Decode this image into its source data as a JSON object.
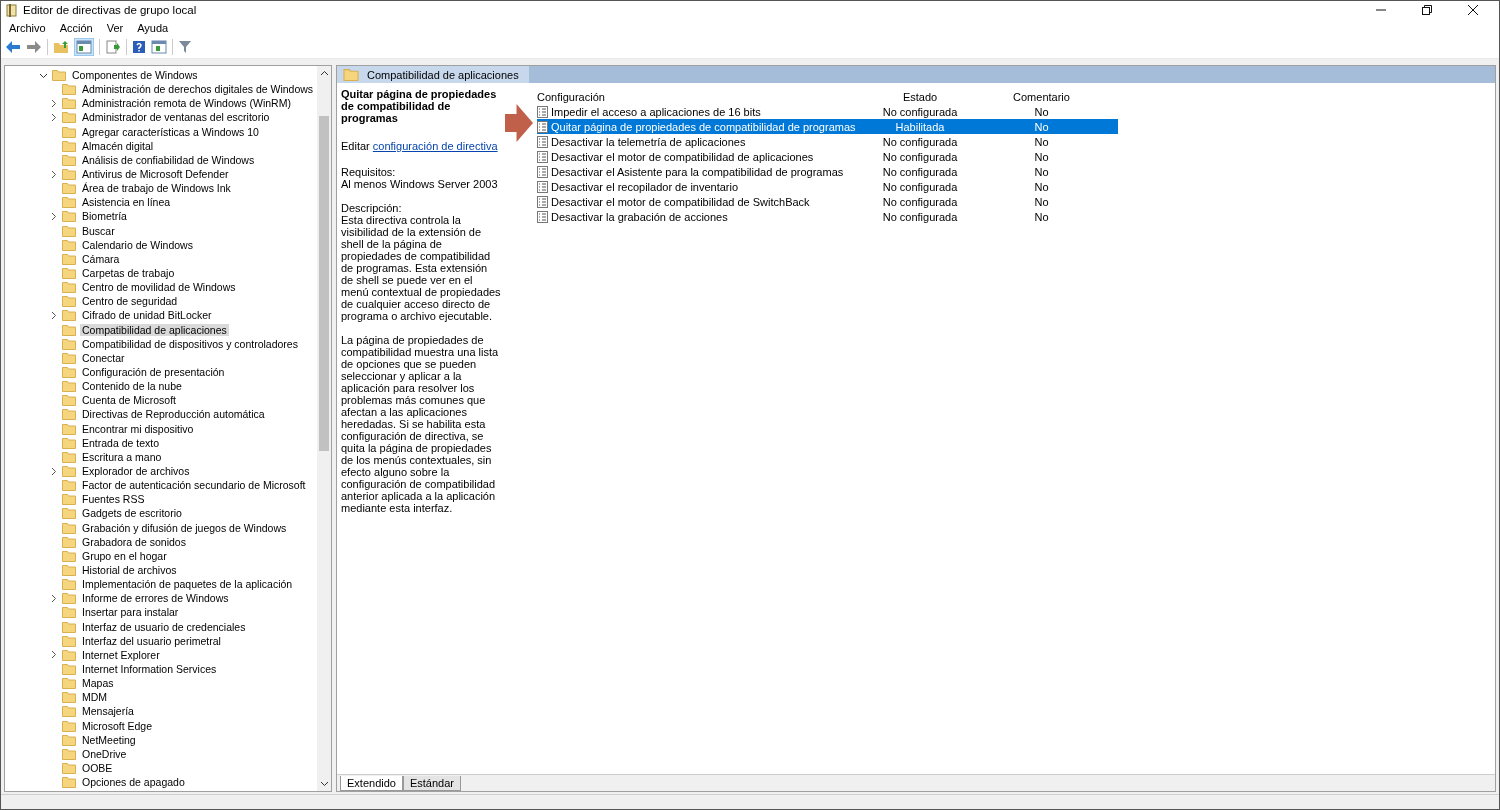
{
  "window": {
    "title": "Editor de directivas de grupo local"
  },
  "menu": [
    "Archivo",
    "Acción",
    "Ver",
    "Ayuda"
  ],
  "tree": [
    {
      "label": "Componentes de Windows",
      "expanded": true,
      "selected": false,
      "children": [
        {
          "label": "Administración de derechos digitales de Windows",
          "expandable": false,
          "selected": false
        },
        {
          "label": "Administración remota de Windows (WinRM)",
          "expandable": true,
          "selected": false
        },
        {
          "label": "Administrador de ventanas del escritorio",
          "expandable": true,
          "selected": false
        },
        {
          "label": "Agregar características a Windows 10",
          "expandable": false,
          "selected": false
        },
        {
          "label": "Almacén digital",
          "expandable": false,
          "selected": false
        },
        {
          "label": "Análisis de confiabilidad de Windows",
          "expandable": false,
          "selected": false
        },
        {
          "label": "Antivirus de Microsoft Defender",
          "expandable": true,
          "selected": false
        },
        {
          "label": "Área de trabajo de Windows Ink",
          "expandable": false,
          "selected": false
        },
        {
          "label": "Asistencia en línea",
          "expandable": false,
          "selected": false
        },
        {
          "label": "Biometría",
          "expandable": true,
          "selected": false
        },
        {
          "label": "Buscar",
          "expandable": false,
          "selected": false
        },
        {
          "label": "Calendario de Windows",
          "expandable": false,
          "selected": false
        },
        {
          "label": "Cámara",
          "expandable": false,
          "selected": false
        },
        {
          "label": "Carpetas de trabajo",
          "expandable": false,
          "selected": false
        },
        {
          "label": "Centro de movilidad de Windows",
          "expandable": false,
          "selected": false
        },
        {
          "label": "Centro de seguridad",
          "expandable": false,
          "selected": false
        },
        {
          "label": "Cifrado de unidad BitLocker",
          "expandable": true,
          "selected": false
        },
        {
          "label": "Compatibilidad de aplicaciones",
          "expandable": false,
          "selected": true
        },
        {
          "label": "Compatibilidad de dispositivos y controladores",
          "expandable": false,
          "selected": false
        },
        {
          "label": "Conectar",
          "expandable": false,
          "selected": false
        },
        {
          "label": "Configuración de presentación",
          "expandable": false,
          "selected": false
        },
        {
          "label": "Contenido de la nube",
          "expandable": false,
          "selected": false
        },
        {
          "label": "Cuenta de Microsoft",
          "expandable": false,
          "selected": false
        },
        {
          "label": "Directivas de Reproducción automática",
          "expandable": false,
          "selected": false
        },
        {
          "label": "Encontrar mi dispositivo",
          "expandable": false,
          "selected": false
        },
        {
          "label": "Entrada de texto",
          "expandable": false,
          "selected": false
        },
        {
          "label": "Escritura a mano",
          "expandable": false,
          "selected": false
        },
        {
          "label": "Explorador de archivos",
          "expandable": true,
          "selected": false
        },
        {
          "label": "Factor de autenticación secundario de Microsoft",
          "expandable": false,
          "selected": false
        },
        {
          "label": "Fuentes RSS",
          "expandable": false,
          "selected": false
        },
        {
          "label": "Gadgets de escritorio",
          "expandable": false,
          "selected": false
        },
        {
          "label": "Grabación y difusión de juegos de Windows",
          "expandable": false,
          "selected": false
        },
        {
          "label": "Grabadora de sonidos",
          "expandable": false,
          "selected": false
        },
        {
          "label": "Grupo en el hogar",
          "expandable": false,
          "selected": false
        },
        {
          "label": "Historial de archivos",
          "expandable": false,
          "selected": false
        },
        {
          "label": "Implementación de paquetes de la aplicación",
          "expandable": false,
          "selected": false
        },
        {
          "label": "Informe de errores de Windows",
          "expandable": true,
          "selected": false
        },
        {
          "label": "Insertar para instalar",
          "expandable": false,
          "selected": false
        },
        {
          "label": "Interfaz de usuario de credenciales",
          "expandable": false,
          "selected": false
        },
        {
          "label": "Interfaz del usuario perimetral",
          "expandable": false,
          "selected": false
        },
        {
          "label": "Internet Explorer",
          "expandable": true,
          "selected": false
        },
        {
          "label": "Internet Information Services",
          "expandable": false,
          "selected": false
        },
        {
          "label": "Mapas",
          "expandable": false,
          "selected": false
        },
        {
          "label": "MDM",
          "expandable": false,
          "selected": false
        },
        {
          "label": "Mensajería",
          "expandable": false,
          "selected": false
        },
        {
          "label": "Microsoft Edge",
          "expandable": false,
          "selected": false
        },
        {
          "label": "NetMeeting",
          "expandable": false,
          "selected": false
        },
        {
          "label": "OneDrive",
          "expandable": false,
          "selected": false
        },
        {
          "label": "OOBE",
          "expandable": false,
          "selected": false
        },
        {
          "label": "Opciones de apagado",
          "expandable": false,
          "selected": false
        }
      ]
    }
  ],
  "header": {
    "title": "Compatibilidad de aplicaciones"
  },
  "details": {
    "title": "Quitar página de propiedades de compatibilidad de programas",
    "edit_label": "Editar",
    "edit_link": "configuración de directiva",
    "requirements_label": "Requisitos:",
    "requirements": "Al menos Windows Server 2003",
    "description_label": "Descripción:",
    "description": [
      "Esta directiva controla la visibilidad de la extensión de shell de la página de propiedades de compatibilidad de programas.  Esta extensión de shell se puede ver en el menú contextual de propiedades de cualquier acceso directo de programa o archivo ejecutable.",
      "La página de propiedades de compatibilidad muestra una lista de opciones que se pueden seleccionar y aplicar a la aplicación para resolver los problemas más comunes que afectan a las aplicaciones heredadas. Si se habilita esta configuración de directiva, se quita la página de propiedades de los menús contextuales, sin efecto alguno sobre la configuración de compatibilidad anterior aplicada a la aplicación mediante esta interfaz."
    ]
  },
  "table": {
    "columns": [
      "Configuración",
      "Estado",
      "Comentario"
    ],
    "rows": [
      {
        "setting": "Impedir el acceso a aplicaciones de 16 bits",
        "state": "No configurada",
        "comment": "No",
        "selected": false
      },
      {
        "setting": "Quitar página de propiedades de compatibilidad de programas",
        "state": "Habilitada",
        "comment": "No",
        "selected": true
      },
      {
        "setting": "Desactivar la telemetría de aplicaciones",
        "state": "No configurada",
        "comment": "No",
        "selected": false
      },
      {
        "setting": "Desactivar el motor de compatibilidad de aplicaciones",
        "state": "No configurada",
        "comment": "No",
        "selected": false
      },
      {
        "setting": "Desactivar el Asistente para la compatibilidad de programas",
        "state": "No configurada",
        "comment": "No",
        "selected": false
      },
      {
        "setting": "Desactivar el recopilador de inventario",
        "state": "No configurada",
        "comment": "No",
        "selected": false
      },
      {
        "setting": "Desactivar el motor de compatibilidad de SwitchBack",
        "state": "No configurada",
        "comment": "No",
        "selected": false
      },
      {
        "setting": "Desactivar la grabación de acciones",
        "state": "No configurada",
        "comment": "No",
        "selected": false
      }
    ]
  },
  "view_tabs": [
    {
      "label": "Extendido",
      "selected": true
    },
    {
      "label": "Estándar",
      "selected": false
    }
  ]
}
